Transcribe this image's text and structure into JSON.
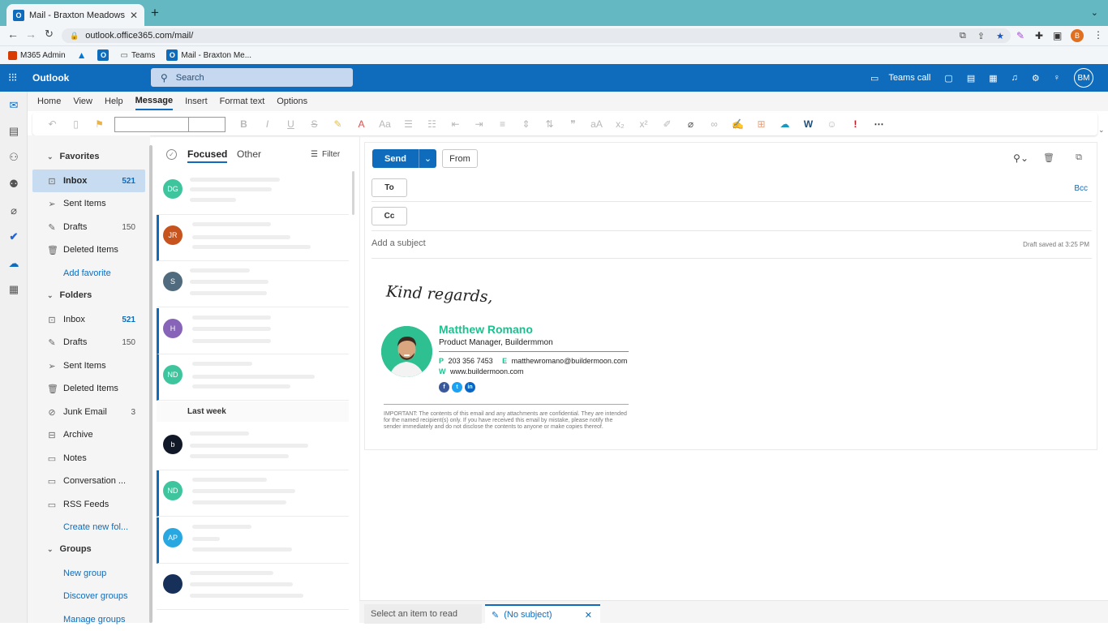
{
  "browser": {
    "tab_title": "Mail - Braxton Meadows - Outlook",
    "new_tab_glyph": "+",
    "url": "outlook.office365.com/mail/",
    "profile_initial": "B",
    "bookmarks": [
      {
        "label": "M365 Admin",
        "icon": "office-icon"
      },
      {
        "label": "",
        "icon": "azure-icon"
      },
      {
        "label": "",
        "icon": "outlook-icon"
      },
      {
        "label": "Teams",
        "icon": "folder-icon"
      },
      {
        "label": "Mail - Braxton Me...",
        "icon": "outlook-icon"
      }
    ]
  },
  "header": {
    "app_name": "Outlook",
    "search_placeholder": "Search",
    "teams_call": "Teams call",
    "avatar_initials": "BM",
    "accent": "#0f6cbd"
  },
  "ribbon": {
    "tabs": [
      "Home",
      "View",
      "Help",
      "Message",
      "Insert",
      "Format text",
      "Options"
    ],
    "active_tab": "Message"
  },
  "folders": {
    "favorites_header": "Favorites",
    "favorites": [
      {
        "label": "Inbox",
        "count": "521",
        "icon": "inbox-icon",
        "selected": true
      },
      {
        "label": "Sent Items",
        "count": "",
        "icon": "send-icon"
      },
      {
        "label": "Drafts",
        "count": "150",
        "icon": "drafts-icon"
      },
      {
        "label": "Deleted Items",
        "count": "",
        "icon": "trash-icon"
      }
    ],
    "add_favorite": "Add favorite",
    "folders_header": "Folders",
    "items": [
      {
        "label": "Inbox",
        "count": "521",
        "icon": "inbox-icon"
      },
      {
        "label": "Drafts",
        "count": "150",
        "icon": "drafts-icon"
      },
      {
        "label": "Sent Items",
        "count": "",
        "icon": "send-icon"
      },
      {
        "label": "Deleted Items",
        "count": "",
        "icon": "trash-icon"
      },
      {
        "label": "Junk Email",
        "count": "3",
        "icon": "junk-icon"
      },
      {
        "label": "Archive",
        "count": "",
        "icon": "archive-icon"
      },
      {
        "label": "Notes",
        "count": "",
        "icon": "notes-icon"
      },
      {
        "label": "Conversation ...",
        "count": "",
        "icon": "folder-icon"
      },
      {
        "label": "RSS Feeds",
        "count": "",
        "icon": "folder-icon"
      }
    ],
    "create_folder": "Create new fol...",
    "groups_header": "Groups",
    "new_group": "New group",
    "discover_groups": "Discover groups",
    "manage_groups": "Manage groups"
  },
  "message_list": {
    "tab_focused": "Focused",
    "tab_other": "Other",
    "filter": "Filter",
    "section_last_week": "Last week",
    "avatars": [
      {
        "initials": "DG",
        "color": "#3fc59d",
        "unread": false
      },
      {
        "initials": "JR",
        "color": "#c7541e",
        "unread": true
      },
      {
        "initials": "S",
        "color": "#4f6b7d",
        "unread": false
      },
      {
        "initials": "H",
        "color": "#8764b8",
        "unread": true
      },
      {
        "initials": "ND",
        "color": "#3fc59d",
        "unread": true
      },
      {
        "initials": "b",
        "color": "#111827",
        "unread": false
      },
      {
        "initials": "ND",
        "color": "#3fc59d",
        "unread": true
      },
      {
        "initials": "AP",
        "color": "#29a7e1",
        "unread": true
      },
      {
        "initials": "",
        "color": "#16305a",
        "unread": false
      }
    ]
  },
  "compose": {
    "send": "Send",
    "from": "From",
    "to": "To",
    "cc": "Cc",
    "bcc": "Bcc",
    "subject_placeholder": "Add a subject",
    "draft_status": "Draft saved at 3:25 PM",
    "closing": "Kind regards,",
    "signature": {
      "name": "Matthew Romano",
      "title": "Product Manager, Buildermmon",
      "phone_label": "P",
      "phone": "203 356 7453",
      "email_label": "E",
      "email": "matthewromano@buildermoon.com",
      "web_label": "W",
      "web": "www.buildermoon.com",
      "social": [
        {
          "letter": "f",
          "icon": "facebook-icon",
          "color": "#3b5998"
        },
        {
          "letter": "t",
          "icon": "twitter-icon",
          "color": "#1da1f2"
        },
        {
          "letter": "in",
          "icon": "linkedin-icon",
          "color": "#0a66c2"
        }
      ],
      "disclaimer": "IMPORTANT: The contents of this email and any attachments are confidential. They are intended for the named recipient(s) only. If you have received this email by mistake, please notify the sender immediately and do not disclose the contents to anyone or make copies thereof."
    }
  },
  "bottom": {
    "read_placeholder": "Select an item to read",
    "draft_tab": "(No subject)"
  }
}
